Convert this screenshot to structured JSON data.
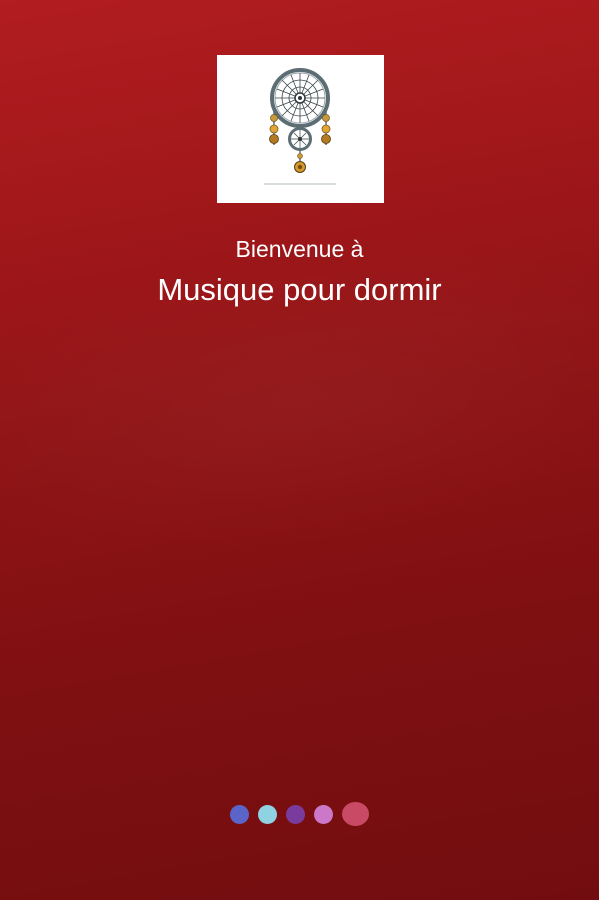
{
  "welcome": {
    "greeting": "Bienvenue à",
    "app_name": "Musique pour dormir"
  },
  "logo": {
    "icon": "dreamcatcher-icon"
  },
  "pager": {
    "current_page": 5,
    "total_pages": 5,
    "dots": [
      {
        "color": "#5b64c8"
      },
      {
        "color": "#8fd3e3"
      },
      {
        "color": "#7a3c9c"
      },
      {
        "color": "#cc78c8"
      },
      {
        "color": "#c84a64"
      }
    ]
  },
  "colors": {
    "background_top": "#b11d20",
    "background_bottom": "#720d0f",
    "text": "#ffffff"
  }
}
